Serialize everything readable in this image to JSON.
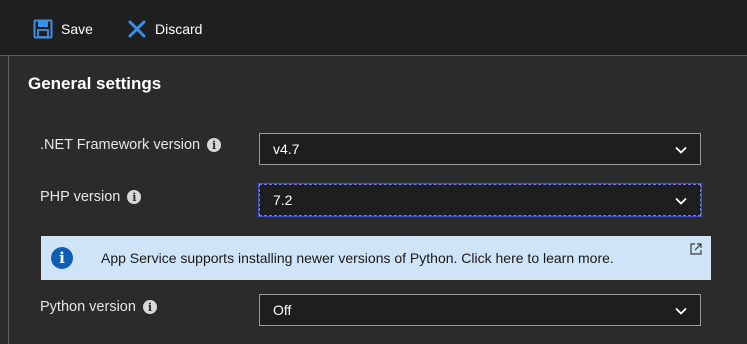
{
  "toolbar": {
    "save_label": "Save",
    "discard_label": "Discard",
    "save_icon": "floppy-disk-icon",
    "discard_icon": "x-icon",
    "accent": "#3a8fe8"
  },
  "section": {
    "title": "General settings"
  },
  "fields": {
    "dotnet": {
      "label": ".NET Framework version",
      "value": "v4.7"
    },
    "php": {
      "label": "PHP version",
      "value": "7.2"
    },
    "python": {
      "label": "Python version",
      "value": "Off"
    }
  },
  "banner": {
    "text": "App Service supports installing newer versions of Python. Click here to learn more.",
    "icon": "info-icon",
    "link_icon": "external-link-icon",
    "background": "#cfe4f6"
  }
}
